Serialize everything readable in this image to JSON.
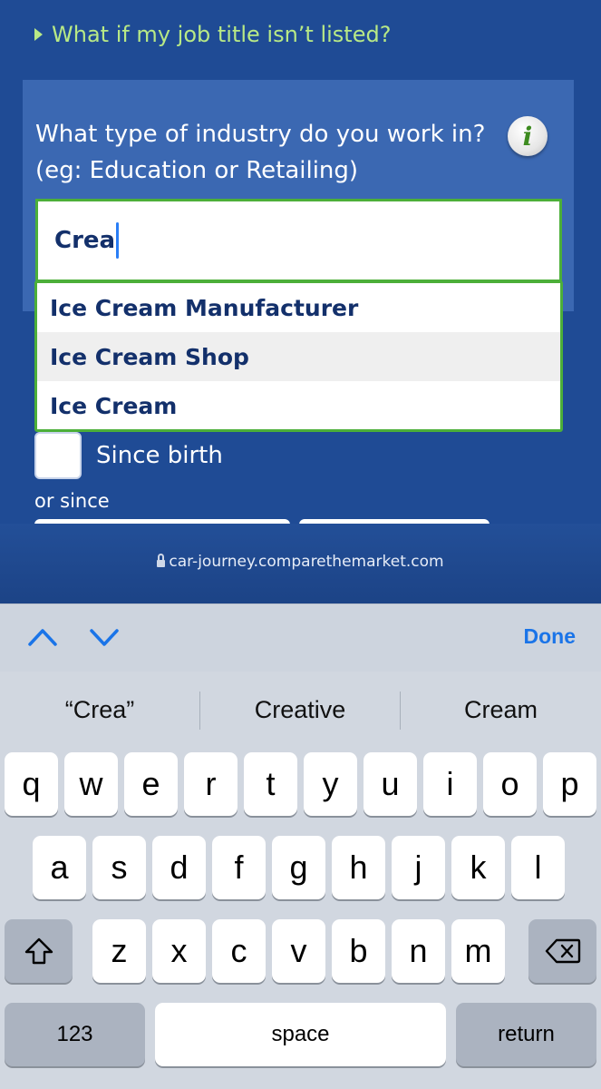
{
  "form": {
    "faq_link": "What if my job title isn’t listed?",
    "industry_question": "What type of industry do you work in? (eg: Education or Retailing)",
    "industry_value": "Crea",
    "suggestions": [
      "Ice Cream Manufacturer",
      "Ice Cream Shop",
      "Ice Cream"
    ],
    "since_birth_label": "Since birth",
    "or_since_label": "or since"
  },
  "browser": {
    "url": "car-journey.comparethemarket.com"
  },
  "accessory": {
    "done_label": "Done"
  },
  "keyboard": {
    "predictions": [
      "“Crea”",
      "Creative",
      "Cream"
    ],
    "row1": [
      "q",
      "w",
      "e",
      "r",
      "t",
      "y",
      "u",
      "i",
      "o",
      "p"
    ],
    "row2": [
      "a",
      "s",
      "d",
      "f",
      "g",
      "h",
      "j",
      "k",
      "l"
    ],
    "row3": [
      "z",
      "x",
      "c",
      "v",
      "b",
      "n",
      "m"
    ],
    "numbers_label": "123",
    "space_label": "space",
    "return_label": "return"
  },
  "colors": {
    "accent_green": "#4caf39",
    "link_green": "#b8e986",
    "brand_blue": "#1f4b95",
    "keyboard_blue": "#1a74e8"
  }
}
